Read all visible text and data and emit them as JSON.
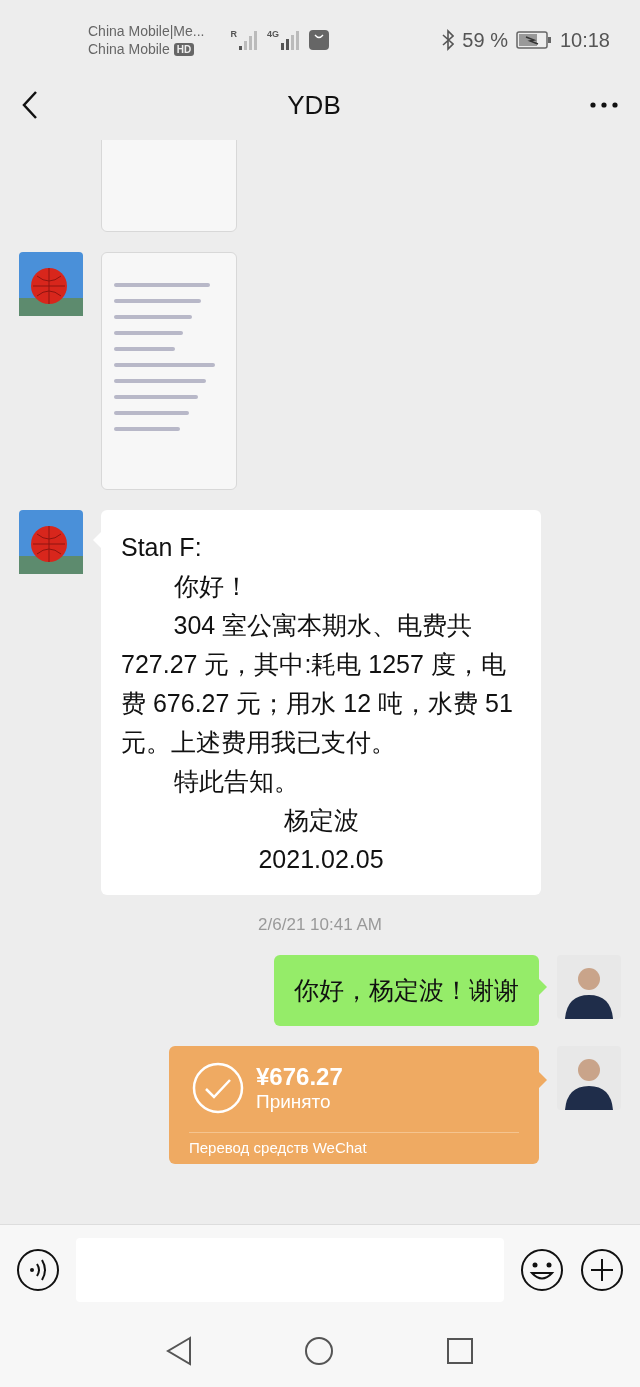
{
  "status_bar": {
    "carrier_1": "China Mobile|Me...",
    "carrier_2": "China Mobile",
    "hd_badge": "HD",
    "roaming": "R",
    "network": "4G",
    "battery": "59 %",
    "time": "10:18"
  },
  "header": {
    "title": "YDB"
  },
  "messages": [
    {
      "kind": "incoming_image_cropped"
    },
    {
      "kind": "incoming_image"
    },
    {
      "kind": "incoming_text",
      "paragraphs": [
        {
          "kind": "plain",
          "text": "Stan F:"
        },
        {
          "kind": "indented",
          "text": "你好！"
        },
        {
          "kind": "indented",
          "text": "304 室公寓本期水、电费共727.27 元，其中:耗电 1257 度，电费 676.27 元；用水 12 吨，水费 51 元。上述费用我已支付。"
        },
        {
          "kind": "indented",
          "text": "特此告知。"
        },
        {
          "kind": "centered",
          "text": "杨定波"
        },
        {
          "kind": "centered",
          "text": "2021.02.05"
        }
      ]
    },
    {
      "kind": "time",
      "text": "2/6/21 10:41 AM"
    },
    {
      "kind": "outgoing_text",
      "paragraphs": [
        {
          "kind": "plain",
          "text": "你好，杨定波！谢谢"
        }
      ]
    },
    {
      "kind": "outgoing_transfer",
      "amount": "¥676.27",
      "status": "Принято",
      "footer": "Перевод средств WeChat"
    }
  ]
}
